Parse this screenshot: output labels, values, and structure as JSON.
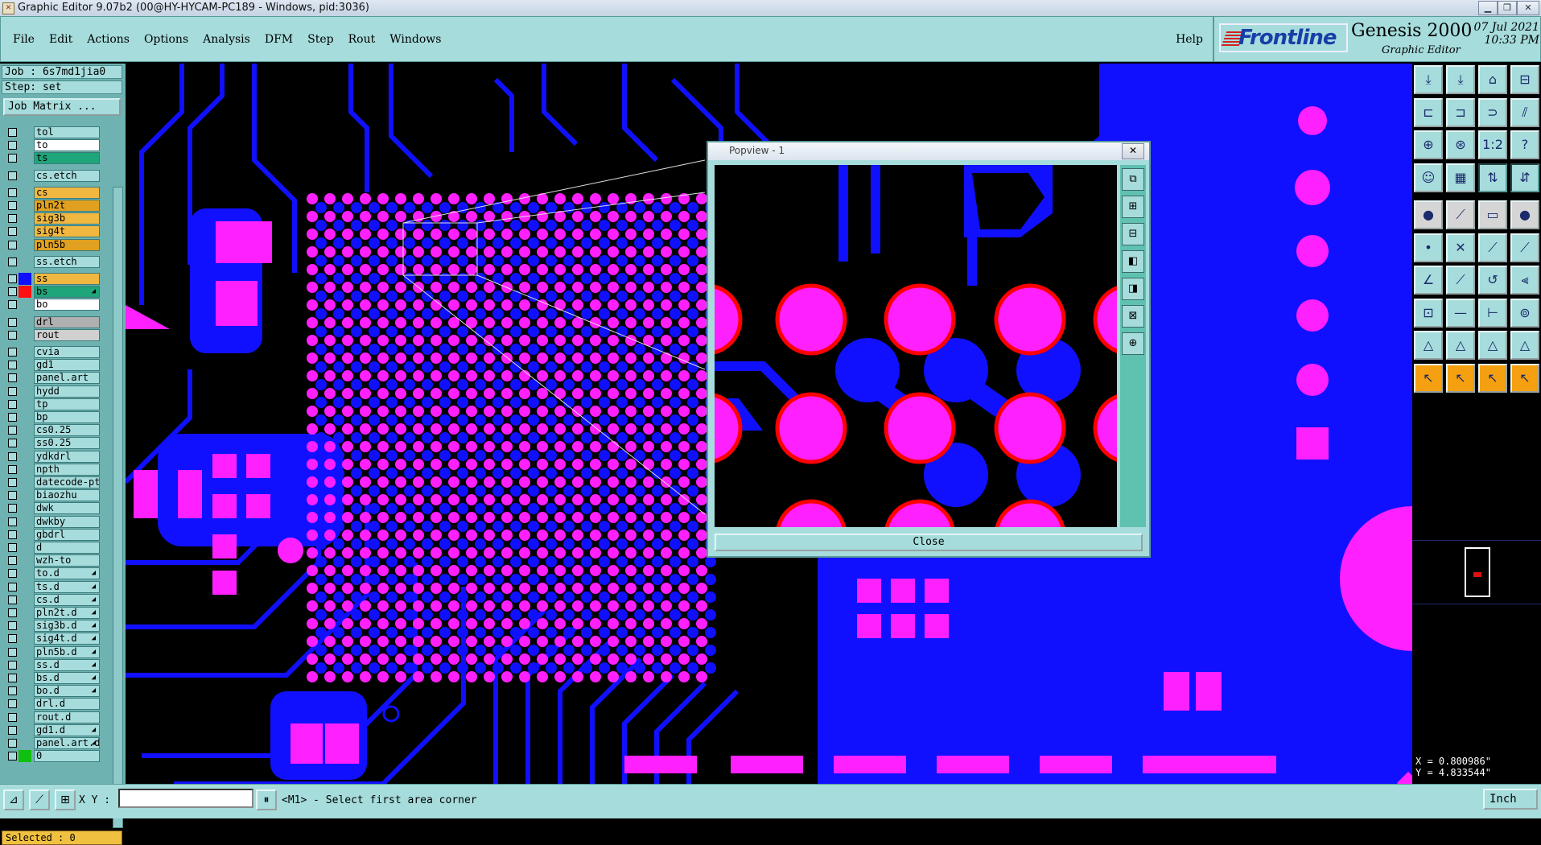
{
  "window": {
    "title": "Graphic Editor 9.07b2 (00@HY-HYCAM-PC189 - Windows, pid:3036)",
    "controls": [
      "minimize",
      "restore",
      "close"
    ]
  },
  "menu": {
    "items": [
      "File",
      "Edit",
      "Actions",
      "Options",
      "Analysis",
      "DFM",
      "Step",
      "Rout",
      "Windows"
    ],
    "help": "Help"
  },
  "brand": {
    "logo_text": "Frontline",
    "product": "Genesis 2000",
    "subtitle": "Graphic Editor",
    "date": "07 Jul 2021",
    "time": "10:33 PM"
  },
  "job": {
    "job_line": "Job : 6s7md1jia0",
    "step_line": "Step: set",
    "job_matrix_button": "Job Matrix ..."
  },
  "layers": [
    {
      "name": "tol",
      "swatch": "",
      "highlight": false
    },
    {
      "name": "to",
      "swatch": "",
      "highlight": false,
      "bg": "#ffffff"
    },
    {
      "name": "ts",
      "swatch": "",
      "highlight": false,
      "bg": "#1fa57a"
    },
    {
      "name": "cs.etch",
      "swatch": "",
      "highlight": false,
      "gap": true
    },
    {
      "name": "cs",
      "swatch": "",
      "highlight": false,
      "bg": "#f0b840",
      "gap": true
    },
    {
      "name": "pln2t",
      "swatch": "",
      "bg": "#e0a020"
    },
    {
      "name": "sig3b",
      "swatch": "",
      "bg": "#f0b840"
    },
    {
      "name": "sig4t",
      "swatch": "",
      "bg": "#f0b840"
    },
    {
      "name": "pln5b",
      "swatch": "",
      "bg": "#e0a020"
    },
    {
      "name": "ss.etch",
      "swatch": "",
      "gap": true
    },
    {
      "name": "ss",
      "swatch": "#1010ff",
      "bg": "#f0b840",
      "gap": true
    },
    {
      "name": "bs",
      "swatch": "#ff1010",
      "bg": "#1fa57a",
      "mark": true
    },
    {
      "name": "bo",
      "swatch": "",
      "bg": "#ffffff"
    },
    {
      "name": "drl",
      "swatch": "",
      "bg": "#b0b0b0",
      "gap": true
    },
    {
      "name": "rout",
      "swatch": "",
      "bg": "#d0d0d0"
    },
    {
      "name": "cvia",
      "swatch": "",
      "gap": true
    },
    {
      "name": "gd1",
      "swatch": ""
    },
    {
      "name": "panel.art",
      "swatch": ""
    },
    {
      "name": "hydd",
      "swatch": ""
    },
    {
      "name": "tp",
      "swatch": ""
    },
    {
      "name": "bp",
      "swatch": ""
    },
    {
      "name": "cs0.25",
      "swatch": ""
    },
    {
      "name": "ss0.25",
      "swatch": ""
    },
    {
      "name": "ydkdrl",
      "swatch": ""
    },
    {
      "name": "npth",
      "swatch": ""
    },
    {
      "name": "datecode-pte",
      "swatch": ""
    },
    {
      "name": "biaozhu",
      "swatch": ""
    },
    {
      "name": "dwk",
      "swatch": ""
    },
    {
      "name": "dwkby",
      "swatch": ""
    },
    {
      "name": "gbdrl",
      "swatch": ""
    },
    {
      "name": "d",
      "swatch": ""
    },
    {
      "name": "wzh-to",
      "swatch": ""
    },
    {
      "name": "to.d",
      "swatch": "",
      "mark": true
    },
    {
      "name": "ts.d",
      "swatch": "",
      "mark": true
    },
    {
      "name": "cs.d",
      "swatch": "",
      "mark": true
    },
    {
      "name": "pln2t.d",
      "swatch": "",
      "mark": true
    },
    {
      "name": "sig3b.d",
      "swatch": "",
      "mark": true
    },
    {
      "name": "sig4t.d",
      "swatch": "",
      "mark": true
    },
    {
      "name": "pln5b.d",
      "swatch": "",
      "mark": true
    },
    {
      "name": "ss.d",
      "swatch": "",
      "mark": true
    },
    {
      "name": "bs.d",
      "swatch": "",
      "mark": true
    },
    {
      "name": "bo.d",
      "swatch": "",
      "mark": true
    },
    {
      "name": "drl.d",
      "swatch": ""
    },
    {
      "name": "rout.d",
      "swatch": ""
    },
    {
      "name": "gd1.d",
      "swatch": "",
      "mark": true
    },
    {
      "name": "panel.art.d",
      "swatch": "",
      "mark": true
    },
    {
      "name": "0",
      "swatch": "#10c010"
    }
  ],
  "selected": "Selected : 0",
  "popview": {
    "title": "Popview - 1",
    "close_x": "✕",
    "close_button": "Close"
  },
  "coords": {
    "x": "X = 0.800986\"",
    "y": "Y = 4.833544\""
  },
  "bottom": {
    "xy_label": "X Y :",
    "xy_value": "",
    "status": "<M1> - Select first area corner",
    "units": "Inch"
  },
  "colors": {
    "board_blue": "#1010ff",
    "pad_magenta": "#ff20ff",
    "pad_outline_red": "#ff0000",
    "panel_teal": "#a6dcdc"
  }
}
